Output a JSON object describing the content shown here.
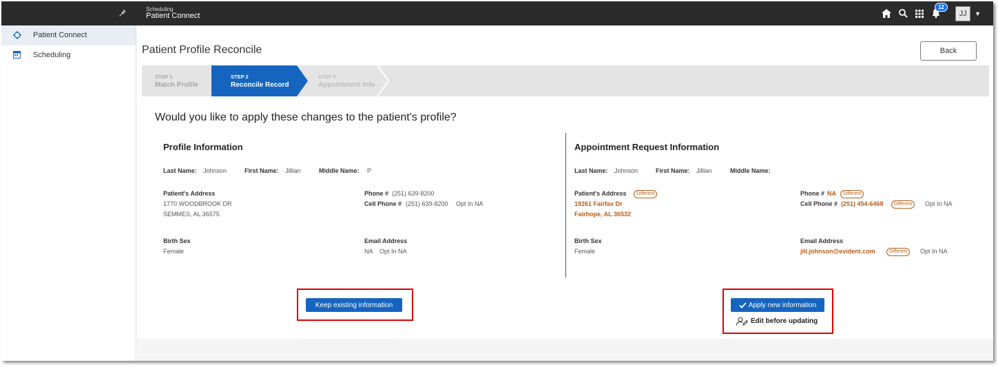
{
  "topbar": {
    "subtitle": "Scheduling",
    "title": "Patient Connect",
    "notification_count": "12",
    "user_initials": "JJ"
  },
  "sidebar": {
    "items": [
      {
        "label": "Patient Connect"
      },
      {
        "label": "Scheduling"
      }
    ]
  },
  "page": {
    "title": "Patient Profile Reconcile",
    "back_label": "Back",
    "question": "Would you like to apply these changes to the patient's profile?"
  },
  "steps": [
    {
      "num": "STEP 1",
      "label": "Match Profile"
    },
    {
      "num": "STEP 2",
      "label": "Reconcile Record"
    },
    {
      "num": "STEP 3",
      "label": "Appointment Info"
    }
  ],
  "profile": {
    "title": "Profile Information",
    "last_name_label": "Last Name:",
    "last_name": "Johnson",
    "first_name_label": "First Name:",
    "first_name": "Jillian",
    "middle_name_label": "Middle Name:",
    "middle_name": "P",
    "address_label": "Patient's Address",
    "address_line1": "1770 WOODBROOK DR",
    "address_line2": "SEMMES, AL 36575",
    "phone_label": "Phone #",
    "phone": "(251) 639-8200",
    "cell_label": "Cell Phone #",
    "cell": "(251) 639-8200",
    "cell_opt": "Opt In NA",
    "birth_sex_label": "Birth Sex",
    "birth_sex": "Female",
    "email_label": "Email Address",
    "email": "NA",
    "email_opt": "Opt In NA"
  },
  "request": {
    "title": "Appointment Request Information",
    "last_name_label": "Last Name:",
    "last_name": "Johnson",
    "first_name_label": "First Name:",
    "first_name": "Jillian",
    "middle_name_label": "Middle Name:",
    "address_label": "Patient's Address",
    "address_diff": "Different",
    "address_line1": "19261 Fairfax Dr",
    "address_line2": "Fairhope, AL 36532",
    "phone_label": "Phone #",
    "phone": "NA",
    "phone_diff": "Different",
    "cell_label": "Cell Phone #",
    "cell": "(251) 454-6468",
    "cell_diff": "Different",
    "cell_opt": "Opt In NA",
    "birth_sex_label": "Birth Sex",
    "birth_sex": "Female",
    "email_label": "Email Address",
    "email": "jill.johnson@evident.com",
    "email_diff": "Different",
    "email_opt": "Opt In NA"
  },
  "actions": {
    "keep_label": "Keep existing information",
    "apply_label": "Apply new information",
    "edit_label": "Edit before updating"
  },
  "colors": {
    "accent": "#1565c0",
    "different": "#b85c1a",
    "highlight_box": "#e00000"
  }
}
